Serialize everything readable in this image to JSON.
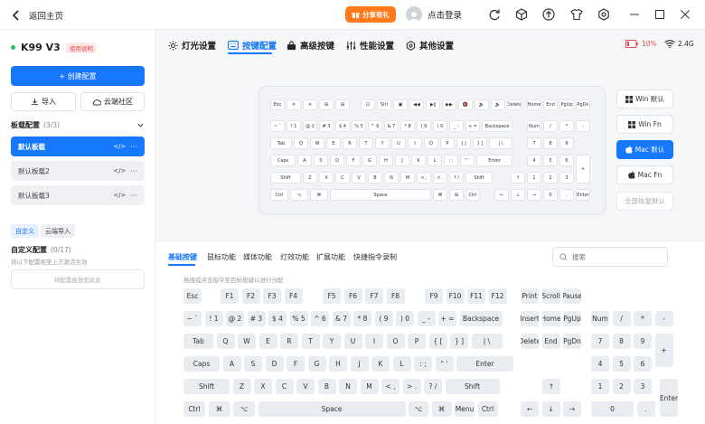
{
  "titlebar": {
    "back_label": "返回主页",
    "share_label": "分享有礼",
    "login_label": "点击登录"
  },
  "device": {
    "name": "K99 V3",
    "badge": "使用说明",
    "battery": "10%",
    "connection": "2.4G"
  },
  "left": {
    "create_btn": "+ 创建配置",
    "import_btn": "导入",
    "cloud_btn": "云端社区",
    "profile_section": "板载配置",
    "profile_count": "(3/3)",
    "profiles": [
      "默认板载",
      "默认板载2",
      "默认板载3"
    ],
    "chips": [
      "自定义",
      "云端导入"
    ],
    "custom_title": "自定义配置",
    "custom_count": "(0/17)",
    "custom_hint": "将以下配置拖至上方激活生效",
    "drop_zone": "将配置拖放到此处"
  },
  "tabs": [
    "灯光设置",
    "按键配置",
    "高级按键",
    "性能设置",
    "其他设置"
  ],
  "active_tab": "按键配置",
  "layouts": [
    "Win 默认",
    "Win Fn",
    "Mac 默认",
    "Mac Fn"
  ],
  "active_layout": "Mac 默认",
  "restore_btn": "全部恢复默认",
  "subtabs": [
    "基础按键",
    "鼠标功能",
    "媒体功能",
    "灯效功能",
    "扩展功能",
    "快捷指令录制"
  ],
  "search_placeholder": "搜索",
  "drag_hint": "拖拽或点击指令至目标按键以进行分配",
  "preview_keys": {
    "row0": [
      "Esc",
      "☀",
      "☀",
      "⊞",
      "⊞",
      "⊡",
      "Siri",
      "▣",
      "◀◀",
      "▶‖",
      "▶▶",
      "🔇",
      "🔉",
      "🔊",
      "Delete",
      "Home",
      "End",
      "PgUp",
      "PgDn"
    ],
    "row1": [
      "~ `",
      "! 1",
      "@ 2",
      "# 3",
      "$ 4",
      "% 5",
      "^ 6",
      "& 7",
      "* 8",
      "( 9",
      ") 0",
      "_ -",
      "+ =",
      "Backspace",
      "Num",
      "/",
      "*",
      "-"
    ],
    "row2": [
      "Tab",
      "Q",
      "W",
      "E",
      "R",
      "T",
      "Y",
      "U",
      "I",
      "O",
      "P",
      "{ [",
      "} ]",
      "| \\",
      "7",
      "8",
      "9"
    ],
    "row3": [
      "Caps",
      "A",
      "S",
      "D",
      "F",
      "G",
      "H",
      "J",
      "K",
      "L",
      ": ;",
      "\" '",
      "Enter",
      "4",
      "5",
      "6",
      "+"
    ],
    "row4": [
      "Shift",
      "Z",
      "X",
      "C",
      "V",
      "B",
      "N",
      "M",
      "< ,",
      "> .",
      "? /",
      "Shift",
      "↑",
      "1",
      "2",
      "3"
    ],
    "row5": [
      "Ctrl",
      "⌥",
      "⌘",
      "Space",
      "⌘",
      "⊞",
      "Ctrl",
      "←",
      "↓",
      "→",
      "0",
      ".",
      "Enter"
    ]
  },
  "palette": {
    "row0": [
      "Esc",
      "F1",
      "F2",
      "F3",
      "F4",
      "F5",
      "F6",
      "F7",
      "F8",
      "F9",
      "F10",
      "F11",
      "F12",
      "Print",
      "Scroll",
      "Pause"
    ],
    "row1": [
      "~ `",
      "! 1",
      "@ 2",
      "# 3",
      "$ 4",
      "% 5",
      "^ 6",
      "& 7",
      "* 8",
      "( 9",
      ") 0",
      "_ -",
      "+ =",
      "Backspace",
      "Insert",
      "Home",
      "PgUp",
      "Num",
      "/",
      "*",
      "-"
    ],
    "row2": [
      "Tab",
      "Q",
      "W",
      "E",
      "R",
      "T",
      "Y",
      "U",
      "I",
      "O",
      "P",
      "{ [",
      "} ]",
      "| \\",
      "Delete",
      "End",
      "PgDn",
      "7",
      "8",
      "9",
      "+"
    ],
    "row3": [
      "Caps",
      "A",
      "S",
      "D",
      "F",
      "G",
      "H",
      "J",
      "K",
      "L",
      ": ;",
      "\" '",
      "Enter",
      "4",
      "5",
      "6"
    ],
    "row4": [
      "Shift",
      "Z",
      "X",
      "C",
      "V",
      "B",
      "N",
      "M",
      "< ,",
      "> .",
      "? /",
      "Shift",
      "↑",
      "1",
      "2",
      "3",
      "Enter"
    ],
    "row5": [
      "Ctrl",
      "⌘",
      "⌥",
      "Space",
      "⌥",
      "⌘",
      "Menu",
      "Ctrl",
      "←",
      "↓",
      "→",
      "0",
      "."
    ]
  },
  "colors": {
    "accent": "#1677ff",
    "share": "#ff7a1a",
    "battery": "#e5484d"
  }
}
